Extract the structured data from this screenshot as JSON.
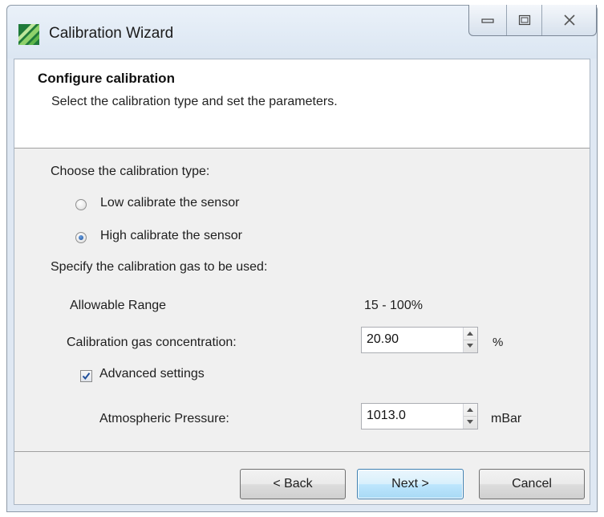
{
  "window": {
    "title": "Calibration Wizard",
    "icon": "calibration-app-icon",
    "controls": [
      "minimize-icon",
      "maximize-icon",
      "close-icon"
    ]
  },
  "header": {
    "title": "Configure calibration",
    "subtitle": "Select the calibration type and set the parameters."
  },
  "calibration_type": {
    "prompt": "Choose the calibration type:",
    "options": [
      {
        "label": "Low calibrate the sensor",
        "selected": false
      },
      {
        "label": "High calibrate the sensor",
        "selected": true
      }
    ]
  },
  "gas": {
    "prompt": "Specify the calibration gas to be used:",
    "range_label": "Allowable Range",
    "range_value": "15 - 100%",
    "concentration_label": "Calibration gas concentration:",
    "concentration_value": "20.90",
    "concentration_unit": "%"
  },
  "advanced": {
    "label": "Advanced settings",
    "checked": true,
    "pressure_label": "Atmospheric Pressure:",
    "pressure_value": "1013.0",
    "pressure_unit": "mBar"
  },
  "buttons": {
    "back": "< Back",
    "next": "Next >",
    "cancel": "Cancel"
  },
  "colors": {
    "accent": "#3c7fb1",
    "radio_dot": "#1b4f9c",
    "window_frame": "#dfe8f3"
  }
}
